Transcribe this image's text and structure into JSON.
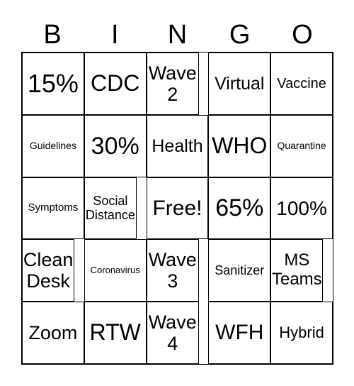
{
  "header": [
    "B",
    "I",
    "N",
    "G",
    "O"
  ],
  "cells": [
    "15%",
    "CDC",
    "Wave 2",
    "Virtual",
    "Vaccine",
    "Guidelines",
    "30%",
    "Health",
    "WHO",
    "Quarantine",
    "Symptoms",
    "Social Distance",
    "Free!",
    "65%",
    "100%",
    "Clean Desk",
    "Coronavirus",
    "Wave 3",
    "Sanitizer",
    "MS Teams",
    "Zoom",
    "RTW",
    "Wave 4",
    "WFH",
    "Hybrid"
  ],
  "colors": {
    "border": "#000000",
    "text": "#000000",
    "background": "#ffffff"
  }
}
